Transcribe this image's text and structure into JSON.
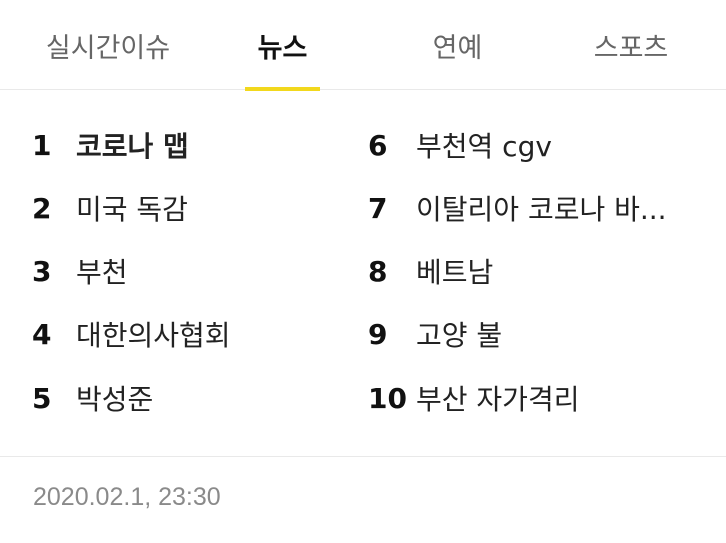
{
  "tabs": [
    {
      "label": "실시간이슈",
      "active": false
    },
    {
      "label": "뉴스",
      "active": true
    },
    {
      "label": "연예",
      "active": false
    },
    {
      "label": "스포츠",
      "active": false
    }
  ],
  "colors": {
    "active_indicator": "#f2d81d",
    "text": "#222222",
    "muted": "#8a8a8a"
  },
  "trending": [
    {
      "rank": "1",
      "keyword": "코로나 맵"
    },
    {
      "rank": "2",
      "keyword": "미국 독감"
    },
    {
      "rank": "3",
      "keyword": "부천"
    },
    {
      "rank": "4",
      "keyword": "대한의사협회"
    },
    {
      "rank": "5",
      "keyword": "박성준"
    },
    {
      "rank": "6",
      "keyword": "부천역 cgv"
    },
    {
      "rank": "7",
      "keyword": "이탈리아 코로나 바..."
    },
    {
      "rank": "8",
      "keyword": "베트남"
    },
    {
      "rank": "9",
      "keyword": "고양 불"
    },
    {
      "rank": "10",
      "keyword": "부산 자가격리"
    }
  ],
  "footer": {
    "timestamp": "2020.02.1, 23:30"
  }
}
